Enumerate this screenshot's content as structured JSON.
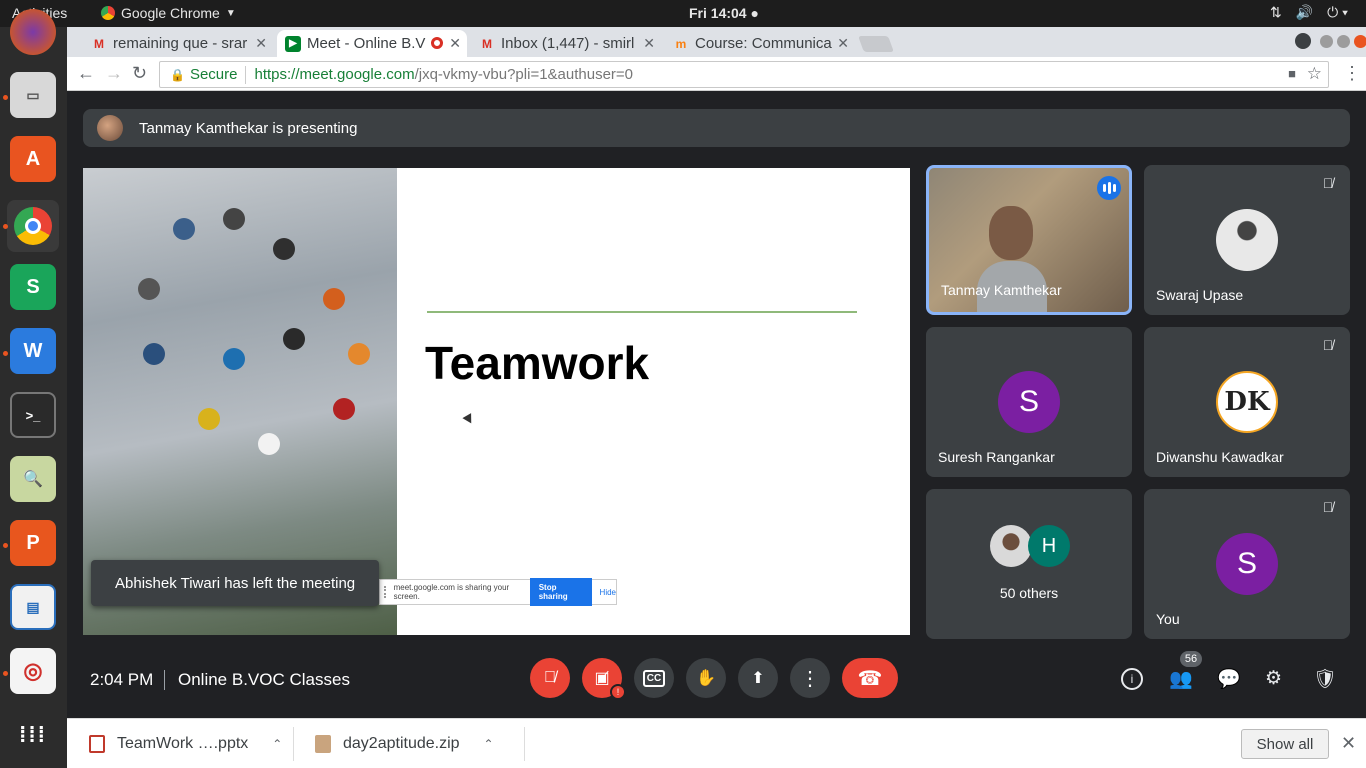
{
  "topbar": {
    "activities": "Activities",
    "app_name": "Google Chrome",
    "clock": "Fri 14:04 ●"
  },
  "dock": {
    "items": [
      "firefox-icon",
      "files-icon",
      "software-icon",
      "chrome-icon",
      "wps-spreadsheet-icon",
      "wps-writer-icon",
      "terminal-icon",
      "image-viewer-icon",
      "wps-presentation-icon",
      "libreoffice-impress-icon",
      "record-icon",
      "app-grid-icon"
    ]
  },
  "tabs": [
    {
      "label": "remaining que - srar",
      "icon": "gmail-icon"
    },
    {
      "label": "Meet - Online B.V",
      "icon": "meet-icon"
    },
    {
      "label": "Inbox (1,447) - smirl",
      "icon": "gmail-icon"
    },
    {
      "label": "Course: Communica",
      "icon": "moodle-icon"
    }
  ],
  "omnibox": {
    "secure_label": "Secure",
    "url_host": "https://meet.google.com",
    "url_path": "/jxq-vkmy-vbu?pli=1&authuser=0"
  },
  "meet": {
    "presenting_banner": "Tanmay Kamthekar is presenting",
    "slide_title": "Teamwork",
    "share_notice": "meet.google.com is sharing your screen.",
    "stop_sharing": "Stop sharing",
    "hide": "Hide",
    "toast": "Abhishek Tiwari has left the meeting",
    "participants": [
      {
        "name": "Tanmay Kamthekar",
        "initial": ""
      },
      {
        "name": "Swaraj Upase",
        "initial": ""
      },
      {
        "name": "Suresh Rangankar",
        "initial": "S",
        "color": "#7b1fa2"
      },
      {
        "name": "Diwanshu Kawadkar",
        "initial": ""
      },
      {
        "name": "50 others",
        "initial": "H",
        "color": "#00796b"
      },
      {
        "name": "You",
        "initial": "S",
        "color": "#7b1fa2"
      }
    ],
    "time": "2:04 PM",
    "meeting_name": "Online B.VOC Classes",
    "participant_count": "56",
    "logo_text": "DK"
  },
  "downloads": [
    {
      "name": "TeamWork ….pptx"
    },
    {
      "name": "day2aptitude.zip"
    }
  ],
  "show_all": "Show all",
  "colors": {
    "accent": "#1a73e8",
    "danger": "#ea4335",
    "surface": "#3c4043",
    "background": "#202124"
  }
}
